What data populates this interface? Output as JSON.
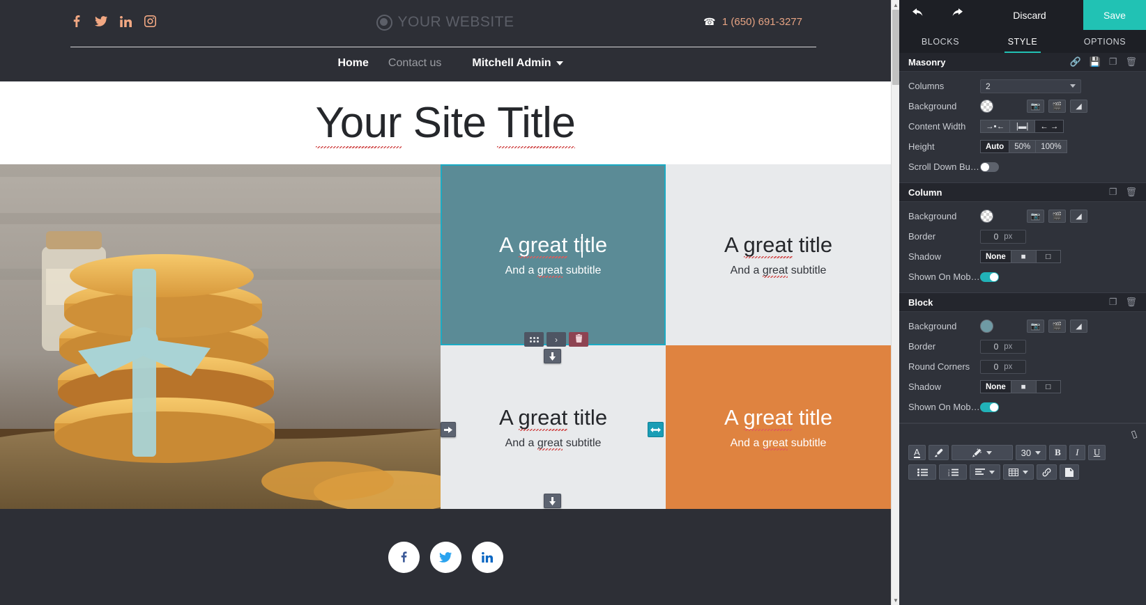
{
  "website": {
    "social_icons": [
      "facebook-icon",
      "twitter-icon",
      "linkedin-icon",
      "instagram-icon"
    ],
    "brand": "YOUR WEBSITE",
    "phone": "1 (650) 691-3277",
    "nav": [
      {
        "label": "Home",
        "active": true
      },
      {
        "label": "Contact us",
        "active": false
      }
    ],
    "user_menu": "Mitchell Admin",
    "page_title": "Your Site Title",
    "masonry_cells": [
      {
        "title": "A great title",
        "subtitle": "And a great subtitle",
        "bg": "#5b8b96",
        "selected": true
      },
      {
        "title": "A great title",
        "subtitle": "And a great subtitle",
        "bg": "#e8eaec",
        "selected": false
      },
      {
        "title": "A great title",
        "subtitle": "And a great subtitle",
        "bg": "#e8eaec",
        "selected": false
      },
      {
        "title": "A great title",
        "subtitle": "And a great subtitle",
        "bg": "#df8340",
        "selected": false
      }
    ],
    "footer_social": [
      "facebook-icon",
      "twitter-icon",
      "linkedin-icon"
    ]
  },
  "block_toolbar": {
    "move_label": "⁙",
    "next_label": "›",
    "delete_label": "🗑"
  },
  "editor": {
    "top_bar": {
      "undo_label": "↺",
      "redo_label": "↻",
      "discard_label": "Discard",
      "save_label": "Save",
      "save_color": "#21c2b4"
    },
    "tabs": [
      {
        "label": "BLOCKS",
        "active": false
      },
      {
        "label": "STYLE",
        "active": true
      },
      {
        "label": "OPTIONS",
        "active": false
      }
    ],
    "sections": [
      {
        "title": "Masonry",
        "header_icons": [
          "link-icon",
          "save-icon",
          "duplicate-icon",
          "trash-icon"
        ],
        "rows": [
          {
            "label": "Columns",
            "type": "select",
            "value": "2"
          },
          {
            "label": "Background",
            "type": "color",
            "swatch": "transparent",
            "icons": [
              "camera-icon",
              "video-icon",
              "gradient-icon"
            ]
          },
          {
            "label": "Content Width",
            "type": "segment",
            "options": [
              "narrow",
              "medium",
              "wide"
            ],
            "selected": 2
          },
          {
            "label": "Height",
            "type": "segment-text",
            "options": [
              "Auto",
              "50%",
              "100%"
            ],
            "selected": 0
          },
          {
            "label": "Scroll Down But...",
            "type": "toggle",
            "value": false
          }
        ]
      },
      {
        "title": "Column",
        "header_icons": [
          "duplicate-icon",
          "trash-icon"
        ],
        "rows": [
          {
            "label": "Background",
            "type": "color",
            "swatch": "transparent",
            "icons": [
              "camera-icon",
              "video-icon",
              "gradient-icon"
            ]
          },
          {
            "label": "Border",
            "type": "number",
            "value": "0",
            "unit": "px"
          },
          {
            "label": "Shadow",
            "type": "segment-text",
            "options": [
              "None",
              "shadow-outset",
              "shadow-inset"
            ],
            "selected": 0
          },
          {
            "label": "Shown On Mobi...",
            "type": "toggle",
            "value": true
          }
        ]
      },
      {
        "title": "Block",
        "header_icons": [
          "duplicate-icon",
          "trash-icon"
        ],
        "rows": [
          {
            "label": "Background",
            "type": "color",
            "swatch": "#6f9aa4",
            "icons": [
              "camera-icon",
              "video-icon",
              "gradient-icon"
            ]
          },
          {
            "label": "Border",
            "type": "number",
            "value": "0",
            "unit": "px"
          },
          {
            "label": "Round Corners",
            "type": "number",
            "value": "0",
            "unit": "px"
          },
          {
            "label": "Shadow",
            "type": "segment-text",
            "options": [
              "None",
              "shadow-outset",
              "shadow-inset"
            ],
            "selected": 0
          },
          {
            "label": "Shown On Mobi...",
            "type": "toggle",
            "value": true
          }
        ]
      }
    ],
    "text_toolbar": {
      "eraser_icon": "eraser-icon",
      "row1": [
        {
          "name": "font-color-button",
          "label": "A"
        },
        {
          "name": "background-color-button",
          "label": "🖌"
        },
        {
          "name": "style-picker-dropdown",
          "label": "✒",
          "caret": true
        },
        {
          "name": "font-size-dropdown",
          "label": "30",
          "caret": true
        },
        {
          "name": "bold-button",
          "label": "B"
        },
        {
          "name": "italic-button",
          "label": "I"
        },
        {
          "name": "underline-button",
          "label": "U"
        }
      ],
      "row2": [
        {
          "name": "unordered-list-button",
          "label": "☰"
        },
        {
          "name": "ordered-list-button",
          "label": "☷"
        },
        {
          "name": "align-dropdown",
          "label": "≡",
          "caret": true
        },
        {
          "name": "table-dropdown",
          "label": "▦",
          "caret": true
        },
        {
          "name": "link-button",
          "label": "🔗"
        },
        {
          "name": "image-button",
          "label": "🖼"
        }
      ],
      "font_size_value": "30"
    }
  }
}
